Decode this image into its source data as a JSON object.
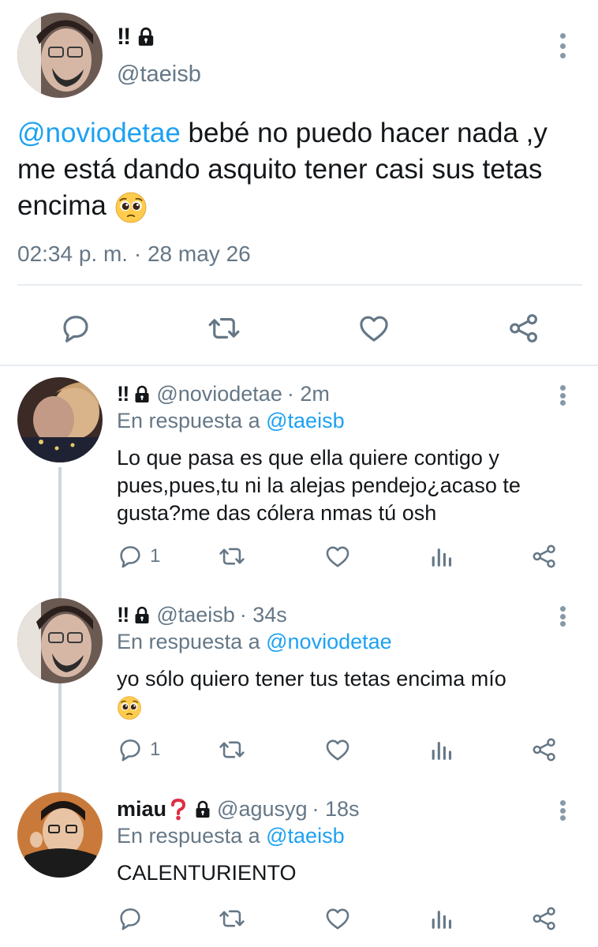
{
  "main_tweet": {
    "name": "‼",
    "handle": "@taeisb",
    "mention": "@noviodetae",
    "text": " bebé no puedo hacer nada ,y me está dando asquito tener casi sus tetas encima",
    "timestamp": "02:34 p. m. · 28 may 26"
  },
  "replies": [
    {
      "name": "‼",
      "handle": "@noviodetae",
      "time": "· 2m",
      "reply_prefix": "En respuesta a ",
      "reply_to": "@taeisb",
      "text": "Lo que pasa es que ella quiere contigo y pues,pues,tu ni la alejas pendejo¿acaso te gusta?me das cólera nmas tú osh",
      "reply_count": "1"
    },
    {
      "name": "‼",
      "handle": "@taeisb",
      "time": "· 34s",
      "reply_prefix": "En respuesta a ",
      "reply_to": "@noviodetae",
      "text": "yo sólo quiero tener tus tetas encima mío",
      "reply_count": "1"
    },
    {
      "name": "miau",
      "handle": "@agusyg",
      "time": "· 18s",
      "reply_prefix": "En respuesta a ",
      "reply_to": "@taeisb",
      "text": "CALENTURIENTO",
      "reply_count": ""
    }
  ],
  "colors": {
    "link": "#1da1f2",
    "muted": "#657786",
    "divider": "#e6ecf0",
    "thread_line": "#ccd6dd"
  },
  "icons": [
    "lock-icon",
    "more-icon",
    "reply-icon",
    "retweet-icon",
    "like-icon",
    "share-icon",
    "analytics-icon",
    "pleading-face-emoji",
    "question-mark-emoji"
  ]
}
